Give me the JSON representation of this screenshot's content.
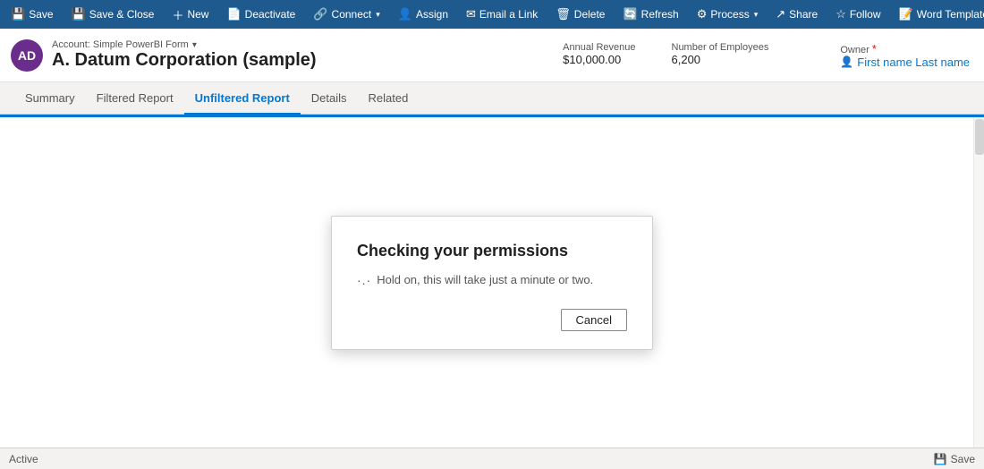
{
  "toolbar": {
    "buttons": [
      {
        "id": "save",
        "icon": "💾",
        "label": "Save",
        "dropdown": false
      },
      {
        "id": "save-close",
        "icon": "💾",
        "label": "Save & Close",
        "dropdown": false
      },
      {
        "id": "new",
        "icon": "+",
        "label": "New",
        "dropdown": false
      },
      {
        "id": "deactivate",
        "icon": "📄",
        "label": "Deactivate",
        "dropdown": false
      },
      {
        "id": "connect",
        "icon": "🔗",
        "label": "Connect",
        "dropdown": true
      },
      {
        "id": "assign",
        "icon": "👤",
        "label": "Assign",
        "dropdown": false
      },
      {
        "id": "email-link",
        "icon": "✉",
        "label": "Email a Link",
        "dropdown": false
      },
      {
        "id": "delete",
        "icon": "🗑",
        "label": "Delete",
        "dropdown": false
      },
      {
        "id": "refresh",
        "icon": "🔄",
        "label": "Refresh",
        "dropdown": false
      },
      {
        "id": "process",
        "icon": "⚙",
        "label": "Process",
        "dropdown": true
      },
      {
        "id": "share",
        "icon": "↗",
        "label": "Share",
        "dropdown": false
      },
      {
        "id": "follow",
        "icon": "☆",
        "label": "Follow",
        "dropdown": false
      },
      {
        "id": "word-templates",
        "icon": "📝",
        "label": "Word Templates",
        "dropdown": true
      }
    ]
  },
  "header": {
    "avatar_initials": "AD",
    "account_label": "Account: Simple PowerBI Form",
    "account_name": "A. Datum Corporation (sample)",
    "fields": [
      {
        "id": "annual-revenue",
        "label": "Annual Revenue",
        "value": "$10,000.00"
      },
      {
        "id": "employees",
        "label": "Number of Employees",
        "value": "6,200"
      }
    ],
    "owner_label": "Owner",
    "owner_link": "First name Last name"
  },
  "tabs": [
    {
      "id": "summary",
      "label": "Summary",
      "active": false
    },
    {
      "id": "filtered-report",
      "label": "Filtered Report",
      "active": false
    },
    {
      "id": "unfiltered-report",
      "label": "Unfiltered Report",
      "active": true
    },
    {
      "id": "details",
      "label": "Details",
      "active": false
    },
    {
      "id": "related",
      "label": "Related",
      "active": false
    }
  ],
  "dialog": {
    "title": "Checking your permissions",
    "body": "Hold on, this will take just a minute or two.",
    "cancel_label": "Cancel",
    "loading_symbol": "·.·"
  },
  "statusbar": {
    "status": "Active",
    "save_label": "Save"
  }
}
